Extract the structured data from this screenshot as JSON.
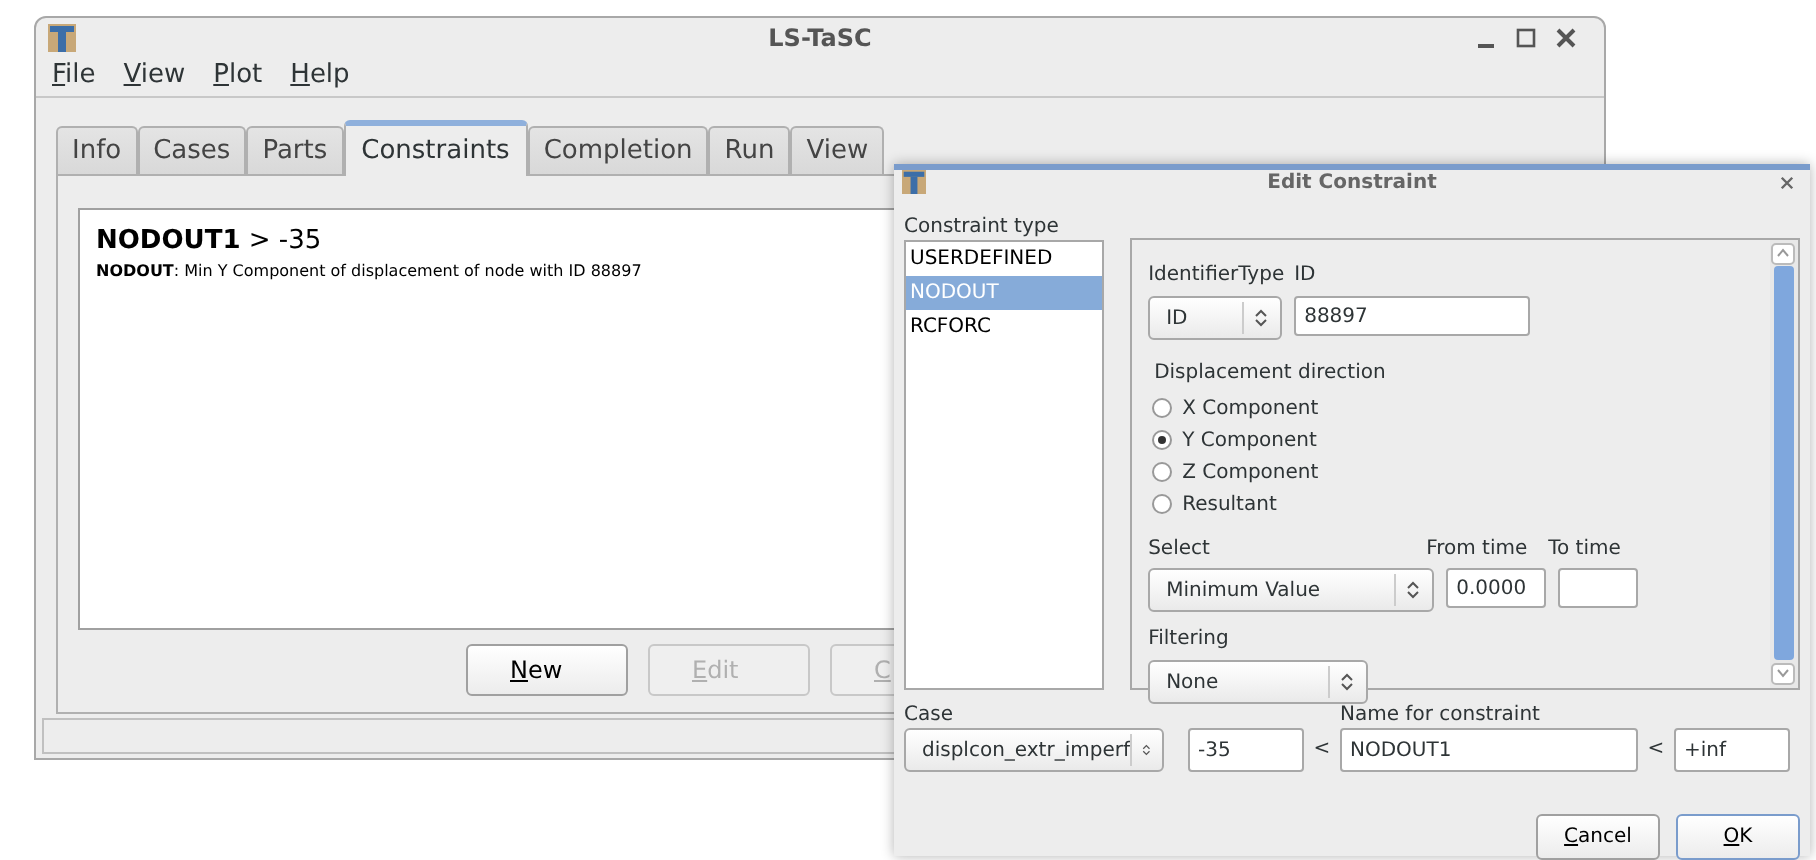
{
  "main_window": {
    "title": "LS-TaSC",
    "menu": [
      "File",
      "View",
      "Plot",
      "Help"
    ],
    "tabs": [
      {
        "label": "Info",
        "selected": false
      },
      {
        "label": "Cases",
        "selected": false
      },
      {
        "label": "Parts",
        "selected": false
      },
      {
        "label": "Constraints",
        "selected": true
      },
      {
        "label": "Completion",
        "selected": false
      },
      {
        "label": "Run",
        "selected": false
      },
      {
        "label": "View",
        "selected": false
      }
    ],
    "constraints": [
      {
        "heading": "**NODOUT1** > -35",
        "description": "**NODOUT**: Min Y Component of displacement of node with ID 88897"
      }
    ],
    "buttons": [
      {
        "label": "New",
        "disabled": false
      },
      {
        "label": "Edit",
        "disabled": true
      },
      {
        "label": "C",
        "disabled": true
      }
    ]
  },
  "dialog": {
    "title": "Edit Constraint",
    "type_label": "Constraint type",
    "types": [
      {
        "label": "USERDEFINED",
        "selected": false
      },
      {
        "label": "NODOUT",
        "selected": true
      },
      {
        "label": "RCFORC",
        "selected": false
      }
    ],
    "identifier_type": {
      "label": "IdentifierType",
      "value": "ID"
    },
    "id": {
      "label": "ID",
      "value": "88897"
    },
    "direction_label": "Displacement direction",
    "directions": [
      {
        "label": "X Component",
        "selected": false
      },
      {
        "label": "Y Component",
        "selected": true
      },
      {
        "label": "Z Component",
        "selected": false
      },
      {
        "label": "Resultant",
        "selected": false
      }
    ],
    "select": {
      "label": "Select",
      "value": "Minimum Value"
    },
    "from_time": {
      "label": "From time",
      "value": "0.0000"
    },
    "to_time": {
      "label": "To time"
    },
    "filtering": {
      "label": "Filtering",
      "value": "None"
    },
    "case": {
      "label": "Case",
      "value": "displcon_extr_imperf"
    },
    "lower_bound": "-35",
    "lower_sign": "<",
    "name": {
      "label": "Name for constraint",
      "value": "NODOUT1"
    },
    "upper_sign": "<",
    "upper_bound": "+inf",
    "buttons": [
      {
        "label": "Cancel",
        "kind": "cancel"
      },
      {
        "label": "OK",
        "kind": "ok"
      }
    ]
  }
}
